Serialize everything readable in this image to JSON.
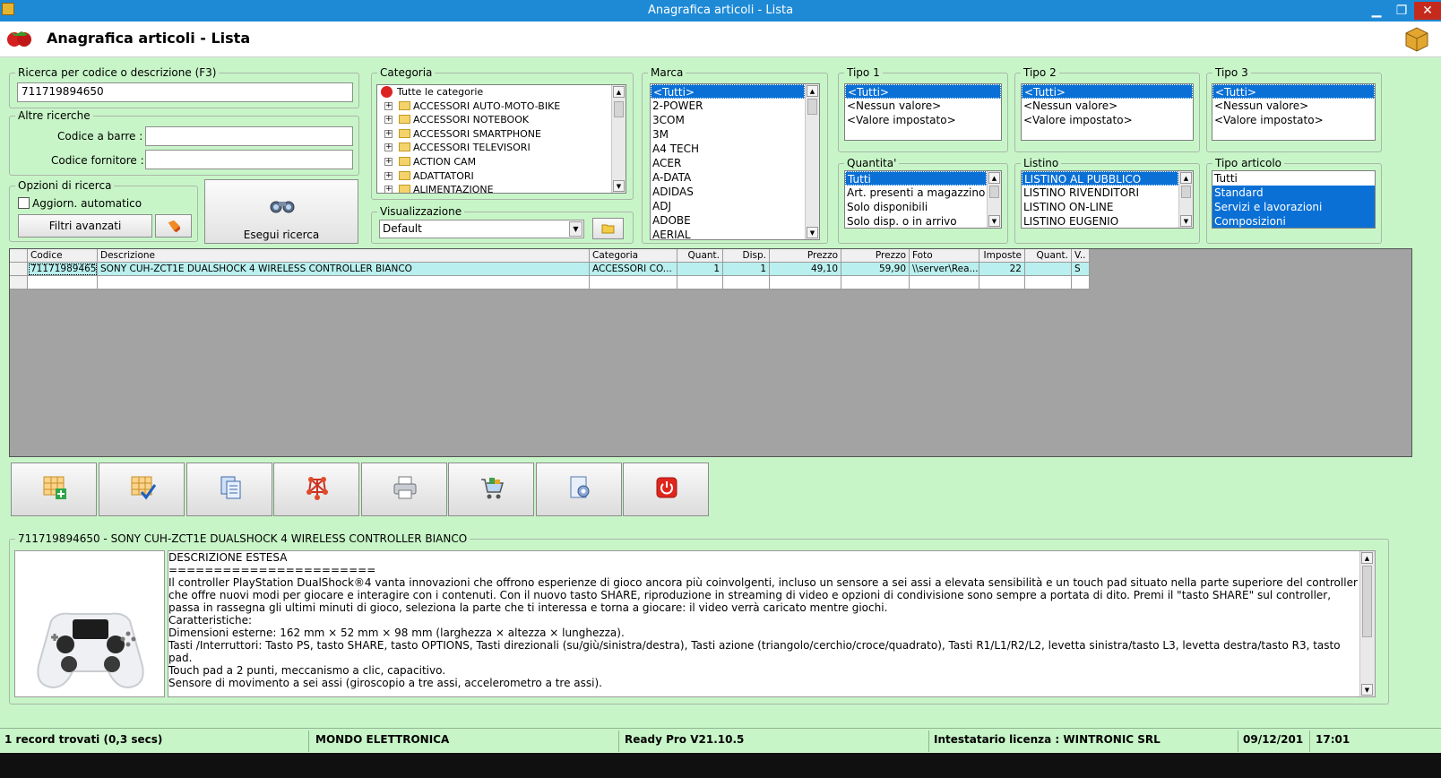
{
  "window": {
    "title": "Anagrafica articoli  - Lista",
    "min": "▁",
    "max": "❐",
    "close": "✕"
  },
  "header": {
    "title": "Anagrafica articoli  - Lista"
  },
  "search": {
    "legend": "Ricerca per codice o descrizione (F3)",
    "value": "711719894650"
  },
  "other": {
    "legend": "Altre ricerche",
    "barcode_label": "Codice a barre :",
    "barcode_value": "",
    "supplier_label": "Codice fornitore :",
    "supplier_value": ""
  },
  "options": {
    "legend": "Opzioni di ricerca",
    "auto_label": "Aggiorn. automatico",
    "filters_label": "Filtri avanzati"
  },
  "run": {
    "label": "Esegui ricerca"
  },
  "categoria": {
    "legend": "Categoria",
    "root": "Tutte le categorie",
    "items": [
      "ACCESSORI AUTO-MOTO-BIKE",
      "ACCESSORI NOTEBOOK",
      "ACCESSORI SMARTPHONE",
      "ACCESSORI TELEVISORI",
      "ACTION CAM",
      "ADATTATORI",
      "ALIMENTAZIONE"
    ]
  },
  "visual": {
    "legend": "Visualizzazione",
    "value": "Default"
  },
  "marca": {
    "legend": "Marca",
    "items": [
      "<Tutti>",
      "2-POWER",
      "3COM",
      "3M",
      "A4 TECH",
      "ACER",
      "A-DATA",
      "ADIDAS",
      "ADJ",
      "ADOBE",
      "AERIAL"
    ]
  },
  "tipo1": {
    "legend": "Tipo 1",
    "items": [
      "<Tutti>",
      "<Nessun valore>",
      "<Valore impostato>"
    ]
  },
  "tipo2": {
    "legend": "Tipo 2",
    "items": [
      "<Tutti>",
      "<Nessun valore>",
      "<Valore impostato>"
    ]
  },
  "tipo3": {
    "legend": "Tipo 3",
    "items": [
      "<Tutti>",
      "<Nessun valore>",
      "<Valore impostato>"
    ]
  },
  "quantita": {
    "legend": "Quantita'",
    "items": [
      "Tutti",
      "Art. presenti a magazzino",
      "Solo disponibili",
      "Solo disp. o in arrivo"
    ]
  },
  "listino": {
    "legend": "Listino",
    "items": [
      "LISTINO AL PUBBLICO",
      "LISTINO RIVENDITORI",
      "LISTINO ON-LINE",
      "LISTINO EUGENIO"
    ]
  },
  "tipoart": {
    "legend": "Tipo articolo",
    "items": [
      "Tutti",
      "Standard",
      "Servizi e lavorazioni",
      "Composizioni"
    ]
  },
  "grid": {
    "headers": [
      "Codice",
      "Descrizione",
      "Categoria",
      "Quant.",
      "Disp.",
      "Prezzo",
      "Prezzo",
      "Foto",
      "Imposte",
      "Quant.",
      "V.."
    ],
    "row": [
      "711719894650",
      "SONY CUH-ZCT1E DUALSHOCK 4 WIRELESS CONTROLLER BIANCO",
      "ACCESSORI CO...",
      "1",
      "1",
      "49,10",
      "59,90",
      "\\\\server\\Rea...",
      "22",
      "",
      "S"
    ]
  },
  "toolbar": [
    "grid-add-icon",
    "grid-check-icon",
    "copy-document-icon",
    "structure-icon",
    "print-icon",
    "cart-icon",
    "settings-document-icon",
    "power-off-icon"
  ],
  "detail": {
    "legend": "711719894650 - SONY CUH-ZCT1E DUALSHOCK 4 WIRELESS CONTROLLER BIANCO",
    "lines": [
      "DESCRIZIONE ESTESA",
      "=======================",
      "Il controller PlayStation DualShock®4 vanta innovazioni che offrono esperienze di gioco ancora più coinvolgenti, incluso un sensore a sei assi a elevata sensibilità e un touch pad situato nella parte superiore del controller che offre nuovi modi per giocare e interagire con i contenuti. Con il nuovo tasto SHARE, riproduzione in streaming di video e opzioni di condivisione sono sempre a portata di dito. Premi il \"tasto SHARE\" sul controller, passa in rassegna gli ultimi minuti di gioco, seleziona la parte che ti interessa e torna a giocare: il video verrà caricato mentre giochi.",
      "Caratteristiche:",
      "Dimensioni esterne: 162 mm × 52 mm × 98 mm (larghezza × altezza × lunghezza).",
      "Tasti /Interruttori: Tasto PS, tasto SHARE, tasto OPTIONS, Tasti direzionali (su/giù/sinistra/destra), Tasti azione (triangolo/cerchio/croce/quadrato), Tasti R1/L1/R2/L2, levetta sinistra/tasto L3, levetta destra/tasto R3, tasto pad.",
      "Touch pad a 2 punti, meccanismo a clic, capacitivo.",
      "Sensore di movimento a sei assi (giroscopio a tre assi, accelerometro a tre assi)."
    ]
  },
  "status": {
    "records": "1 record trovati (0,3 secs)",
    "company": "MONDO ELETTRONICA",
    "version": "Ready Pro V21.10.5",
    "license": "Intestatario licenza : WINTRONIC SRL",
    "date": "09/12/201",
    "time": "17:01"
  }
}
